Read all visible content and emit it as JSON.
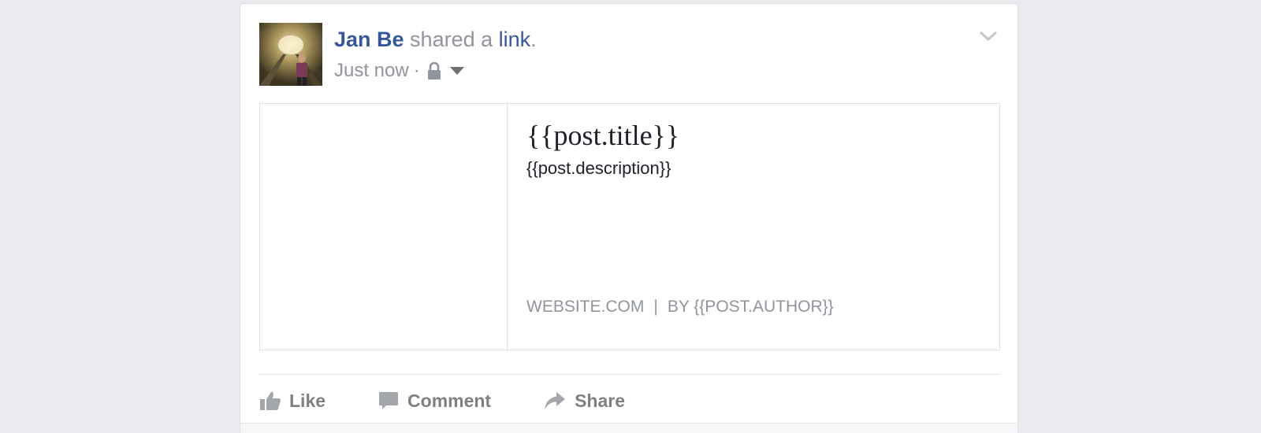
{
  "post": {
    "author_name": "Jan Be",
    "action_text": " shared a ",
    "link_word": "link",
    "period": ".",
    "timestamp": "Just now",
    "meta_separator": "·",
    "privacy_icon": "lock-icon",
    "options_icon": "chevron-down-icon"
  },
  "attachment": {
    "title": "{{post.title}}",
    "description": "{{post.description}}",
    "domain": "WEBSITE.COM",
    "caption_separator": "|",
    "byline": "BY {{POST.AUTHOR}}"
  },
  "actions": {
    "like_label": "Like",
    "comment_label": "Comment",
    "share_label": "Share"
  },
  "colors": {
    "link_blue": "#365899",
    "meta_gray": "#90949c",
    "action_gray": "#7f7f7f",
    "background": "#e9ebee"
  }
}
